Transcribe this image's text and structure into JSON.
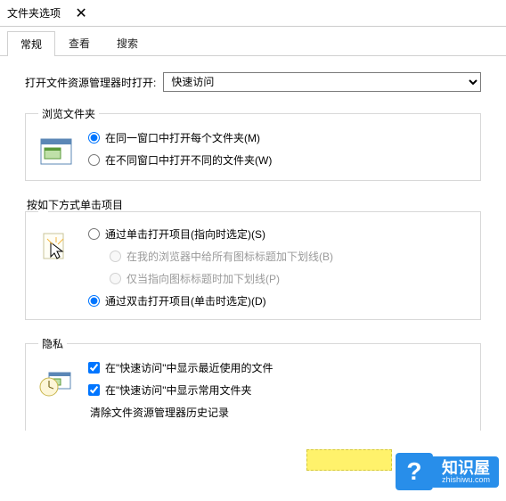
{
  "title": "文件夹选项",
  "tabs": [
    "常规",
    "查看",
    "搜索"
  ],
  "open_label": "打开文件资源管理器时打开:",
  "open_value": "快速访问",
  "group1": {
    "legend": "浏览文件夹",
    "opt1": "在同一窗口中打开每个文件夹(M)",
    "opt2": "在不同窗口中打开不同的文件夹(W)"
  },
  "click_label": "按如下方式单击项目",
  "group2": {
    "opt1": "通过单击打开项目(指向时选定)(S)",
    "sub1": "在我的浏览器中给所有图标标题加下划线(B)",
    "sub2": "仅当指向图标标题时加下划线(P)",
    "opt2": "通过双击打开项目(单击时选定)(D)"
  },
  "group3": {
    "legend": "隐私",
    "chk1": "在\"快速访问\"中显示最近使用的文件",
    "chk2": "在\"快速访问\"中显示常用文件夹",
    "clear": "清除文件资源管理器历史记录"
  },
  "watermark": {
    "big": "知识屋",
    "small": "zhishiwu.com",
    "q": "?"
  }
}
